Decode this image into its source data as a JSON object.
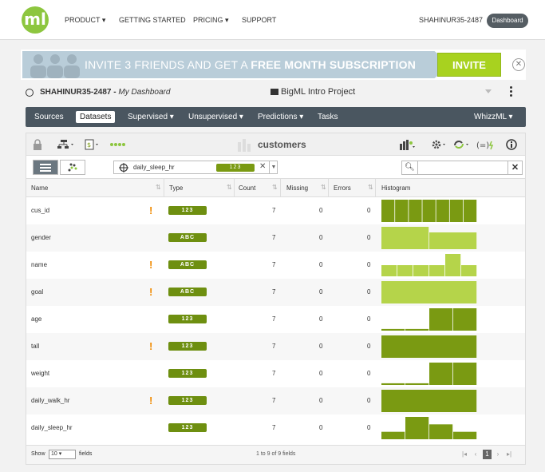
{
  "topnav": {
    "logo": "ml",
    "items": [
      "PRODUCT ▾",
      "GETTING STARTED",
      "PRICING ▾",
      "SUPPORT"
    ],
    "user": "SHAHINUR35-2487",
    "dashboard_button": "Dashboard"
  },
  "banner": {
    "text_regular": "INVITE 3 FRIENDS AND GET A ",
    "text_bold": "FREE MONTH SUBSCRIPTION",
    "invite_button": "INVITE",
    "close": "✕"
  },
  "dashline": {
    "user": "SHAHINUR35-2487 - ",
    "dashboard": "My Dashboard",
    "project": "BigML Intro Project"
  },
  "mainbar": {
    "items": [
      "Sources",
      "Datasets",
      "Supervised ▾",
      "Unsupervised ▾",
      "Predictions ▾",
      "Tasks"
    ],
    "active": "Datasets",
    "whizzml": "WhizzML ▾"
  },
  "toolbar": {
    "dataset_name": "customers"
  },
  "field_selector": {
    "field": "daily_sleep_hr",
    "type": "123"
  },
  "search": {
    "placeholder": ""
  },
  "table": {
    "columns": [
      "Name",
      "Type",
      "Count",
      "Missing",
      "Errors",
      "Histogram"
    ],
    "rows": [
      {
        "name": "cus_id",
        "warn": true,
        "type": "123",
        "count": "7",
        "missing": "0",
        "errors": "0",
        "hist": [
          1,
          1,
          1,
          1,
          1,
          1,
          1
        ]
      },
      {
        "name": "gender",
        "warn": false,
        "type": "ABC",
        "count": "7",
        "missing": "0",
        "errors": "0",
        "hist": [
          4,
          3
        ]
      },
      {
        "name": "name",
        "warn": true,
        "type": "ABC",
        "count": "7",
        "missing": "0",
        "errors": "0",
        "hist": [
          1,
          1,
          1,
          1,
          2,
          1
        ]
      },
      {
        "name": "goal",
        "warn": true,
        "type": "ABC",
        "count": "7",
        "missing": "0",
        "errors": "0",
        "hist": [
          7
        ]
      },
      {
        "name": "age",
        "warn": false,
        "type": "123",
        "count": "7",
        "missing": "0",
        "errors": "0",
        "hist": [
          0.15,
          0.15,
          2,
          2
        ]
      },
      {
        "name": "tall",
        "warn": true,
        "type": "123",
        "count": "7",
        "missing": "0",
        "errors": "0",
        "hist": [
          7
        ]
      },
      {
        "name": "weight",
        "warn": false,
        "type": "123",
        "count": "7",
        "missing": "0",
        "errors": "0",
        "hist": [
          0.15,
          0.15,
          2,
          2
        ]
      },
      {
        "name": "daily_walk_hr",
        "warn": true,
        "type": "123",
        "count": "7",
        "missing": "0",
        "errors": "0",
        "hist": [
          7
        ]
      },
      {
        "name": "daily_sleep_hr",
        "warn": false,
        "type": "123",
        "count": "7",
        "missing": "0",
        "errors": "0",
        "hist": [
          1,
          3,
          2,
          1
        ]
      }
    ]
  },
  "footer": {
    "show": "Show",
    "per_page": "10",
    "fields": "fields",
    "page_info": "1 to 9 of 9 fields",
    "current_page": "1"
  },
  "colors": {
    "accent_green": "#8dc63f",
    "hist_dark": "#7a9a12",
    "hist_light": "#b5d44a",
    "type_badge": "#6e8f10",
    "warning": "#f08a00",
    "mainbar": "#4a5660"
  }
}
